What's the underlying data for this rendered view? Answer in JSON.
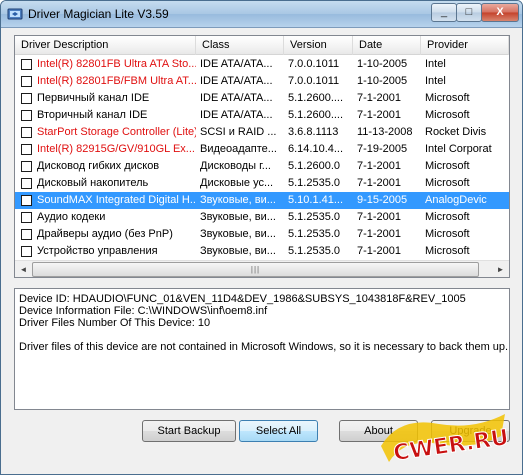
{
  "window": {
    "title": "Driver Magician Lite V3.59"
  },
  "controls": {
    "minimize": "_",
    "maximize": "□",
    "close": "X"
  },
  "columns": [
    "Driver Description",
    "Class",
    "Version",
    "Date",
    "Provider"
  ],
  "rows": [
    {
      "desc": "Intel(R) 82801FB Ultra ATA Sto...",
      "cls": "IDE ATA/ATA...",
      "ver": "7.0.0.1011",
      "date": "1-10-2005",
      "prov": "Intel",
      "red": true
    },
    {
      "desc": "Intel(R) 82801FB/FBM Ultra AT...",
      "cls": "IDE ATA/ATA...",
      "ver": "7.0.0.1011",
      "date": "1-10-2005",
      "prov": "Intel",
      "red": true
    },
    {
      "desc": "Первичный канал IDE",
      "cls": "IDE ATA/ATA...",
      "ver": "5.1.2600....",
      "date": "7-1-2001",
      "prov": "Microsoft",
      "red": false
    },
    {
      "desc": "Вторичный канал IDE",
      "cls": "IDE ATA/ATA...",
      "ver": "5.1.2600....",
      "date": "7-1-2001",
      "prov": "Microsoft",
      "red": false
    },
    {
      "desc": "StarPort Storage Controller (Lite)",
      "cls": "SCSI и RAID ...",
      "ver": "3.6.8.1113",
      "date": "11-13-2008",
      "prov": "Rocket Divis",
      "red": true
    },
    {
      "desc": "Intel(R) 82915G/GV/910GL Ex...",
      "cls": "Видеоадапте...",
      "ver": "6.14.10.4...",
      "date": "7-19-2005",
      "prov": "Intel Corporat",
      "red": true
    },
    {
      "desc": "Дисковод гибких дисков",
      "cls": "Дисководы г...",
      "ver": "5.1.2600.0",
      "date": "7-1-2001",
      "prov": "Microsoft",
      "red": false
    },
    {
      "desc": "Дисковый накопитель",
      "cls": "Дисковые ус...",
      "ver": "5.1.2535.0",
      "date": "7-1-2001",
      "prov": "Microsoft",
      "red": false
    },
    {
      "desc": "SoundMAX Integrated Digital H...",
      "cls": "Звуковые, ви...",
      "ver": "5.10.1.41...",
      "date": "9-15-2005",
      "prov": "AnalogDevic",
      "red": true,
      "selected": true
    },
    {
      "desc": "Аудио кодеки",
      "cls": "Звуковые, ви...",
      "ver": "5.1.2535.0",
      "date": "7-1-2001",
      "prov": "Microsoft",
      "red": false
    },
    {
      "desc": "Драйверы аудио (без PnP)",
      "cls": "Звуковые, ви...",
      "ver": "5.1.2535.0",
      "date": "7-1-2001",
      "prov": "Microsoft",
      "red": false
    },
    {
      "desc": "Устройство управления",
      "cls": "Звуковые, ви...",
      "ver": "5.1.2535.0",
      "date": "7-1-2001",
      "prov": "Microsoft",
      "red": false
    }
  ],
  "scrollbar": {
    "left_arrow": "◄",
    "right_arrow": "►",
    "grip": "|||"
  },
  "info": {
    "line1": "Device ID: HDAUDIO\\FUNC_01&VEN_11D4&DEV_1986&SUBSYS_1043818F&REV_1005",
    "line2": "Device Information File: C:\\WINDOWS\\inf\\oem8.inf",
    "line3": "Driver Files Number Of This Device: 10",
    "line4": "Driver files of this device are not contained in Microsoft Windows, so it is necessary to back them up."
  },
  "buttons": {
    "start_backup": "Start Backup",
    "select_all": "Select All",
    "about": "About",
    "upgrade": "Upgrade"
  },
  "watermark": {
    "text": "CWER.RU"
  }
}
